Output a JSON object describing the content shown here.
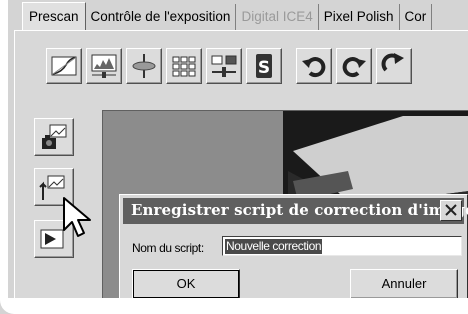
{
  "tabs": [
    {
      "label": "Prescan",
      "state": "active"
    },
    {
      "label": "Contrôle de l'exposition",
      "state": "normal"
    },
    {
      "label": "Digital ICE4",
      "state": "disabled"
    },
    {
      "label": "Pixel Polish",
      "state": "normal"
    },
    {
      "label": "Cor",
      "state": "normal"
    }
  ],
  "toolbar": {
    "icons": [
      "curve-icon",
      "levels-icon",
      "color-balance-icon",
      "grid-icon",
      "slider-icon",
      "script-icon",
      "undo-icon",
      "redo-icon",
      "reset-icon"
    ]
  },
  "sidebar": {
    "icons": [
      "camera-load-icon",
      "save-script-icon",
      "apply-icon"
    ]
  },
  "dialog": {
    "title": "Enregistrer script de correction d'image",
    "field_label": "Nom du script:",
    "field_value": "Nouvelle correction",
    "ok_label": "OK",
    "cancel_label": "Annuler"
  },
  "colors": {
    "panel": "#d4d4d4",
    "titlebar": "#5f5f5f",
    "selection": "#4a4a4a"
  }
}
